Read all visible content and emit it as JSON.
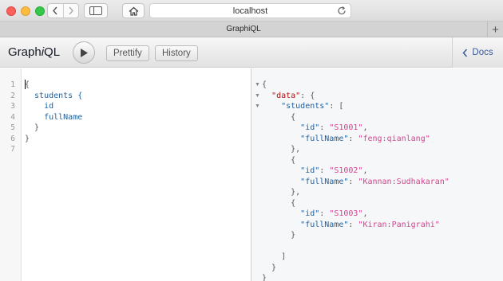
{
  "browser": {
    "url": "localhost",
    "tab_title": "GraphiQL",
    "new_tab_symbol": "+"
  },
  "toolbar": {
    "title_part1": "Graph",
    "title_italic": "i",
    "title_part2": "QL",
    "prettify_label": "Prettify",
    "history_label": "History",
    "docs_label": "Docs"
  },
  "query_editor": {
    "line_numbers": [
      "1",
      "2",
      "3",
      "4",
      "5",
      "6",
      "7"
    ],
    "lines": [
      "{",
      "  students {",
      "    id",
      "    fullName",
      "  }",
      "}",
      ""
    ]
  },
  "result": {
    "lines": [
      "{",
      "  \"data\": {",
      "    \"students\": [",
      "      {",
      "        \"id\": \"S1001\",",
      "        \"fullName\": \"feng:qianlang\"",
      "      },",
      "      {",
      "        \"id\": \"S1002\",",
      "        \"fullName\": \"Kannan:Sudhakaran\"",
      "      },",
      "      {",
      "        \"id\": \"S1003\",",
      "        \"fullName\": \"Kiran:Panigrahi\"",
      "      }",
      "    ]",
      "  }",
      "}"
    ],
    "students": [
      {
        "id": "S1001",
        "fullName": "feng:qianlang"
      },
      {
        "id": "S1002",
        "fullName": "Kannan:Sudhakaran"
      },
      {
        "id": "S1003",
        "fullName": "Kiran:Panigrahi"
      }
    ]
  },
  "colors": {
    "accent": "#3b5998",
    "field": "#1f61a0",
    "string": "#d64292",
    "root_key": "#aa1111"
  },
  "icons": [
    "back-icon",
    "forward-icon",
    "sidebar-icon",
    "home-icon",
    "reload-icon",
    "add-tab-icon",
    "play-icon",
    "chevron-left-icon"
  ]
}
